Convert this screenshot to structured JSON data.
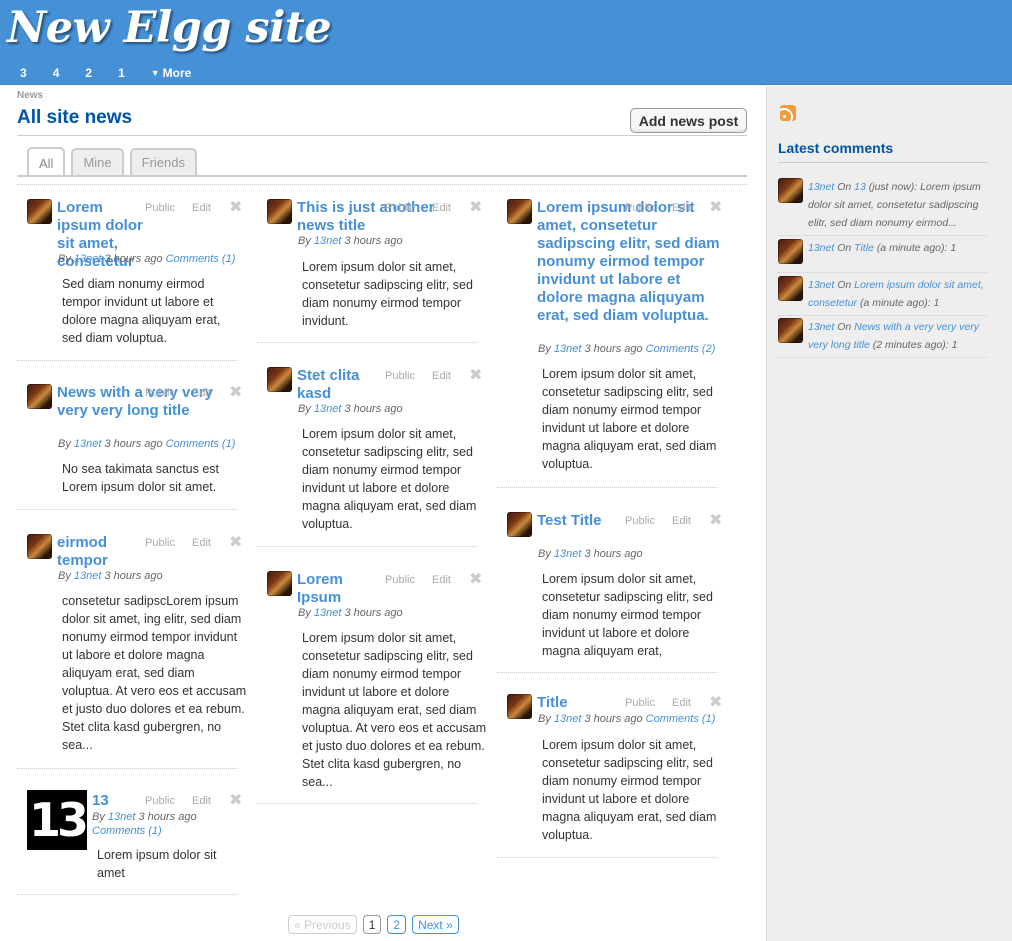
{
  "header": {
    "site_title": "New Elgg site",
    "nav": [
      "3",
      "4",
      "2",
      "1"
    ],
    "more_label": "More"
  },
  "breadcrumb": "News",
  "page_title": "All site news",
  "add_button": "Add news post",
  "tabs": [
    "All",
    "Mine",
    "Friends"
  ],
  "post_meta": {
    "access": "Public",
    "edit": "Edit",
    "delete": "✖"
  },
  "posts": [
    {
      "title": "Lorem ipsum dolor sit amet, consetetur",
      "by": "By",
      "author": "13net",
      "time": "3 hours ago",
      "comments": "Comments (1)",
      "excerpt": "Sed diam nonumy eirmod tempor invidunt ut labore et dolore magna aliquyam erat, sed diam voluptua."
    },
    {
      "title": "News with a very very very very long title",
      "by": "By",
      "author": "13net",
      "time": "3 hours ago",
      "comments": "Comments (1)",
      "excerpt": "No sea takimata sanctus est Lorem ipsum dolor sit amet."
    },
    {
      "title": "eirmod tempor",
      "by": "By",
      "author": "13net",
      "time": "3 hours ago",
      "comments": "",
      "excerpt": "consetetur sadipscLorem ipsum dolor sit amet, ing elitr, sed diam nonumy eirmod tempor invidunt ut labore et dolore magna aliquyam erat, sed diam voluptua. At vero eos et accusam et justo duo dolores et ea rebum. Stet clita kasd gubergren, no sea..."
    },
    {
      "title": "13",
      "by": "By",
      "author": "13net",
      "time": "3 hours ago",
      "comments": "Comments (1)",
      "excerpt": "Lorem ipsum dolor sit amet"
    },
    {
      "title": "This is just another news title",
      "by": "By",
      "author": "13net",
      "time": "3 hours ago",
      "comments": "",
      "excerpt": "Lorem ipsum dolor sit amet, consetetur sadipscing elitr, sed diam nonumy eirmod tempor invidunt."
    },
    {
      "title": "Stet clita kasd",
      "by": "By",
      "author": "13net",
      "time": "3 hours ago",
      "comments": "",
      "excerpt": "Lorem ipsum dolor sit amet, consetetur sadipscing elitr, sed diam nonumy eirmod tempor invidunt ut labore et dolore magna aliquyam erat, sed diam voluptua."
    },
    {
      "title": "Lorem Ipsum",
      "by": "By",
      "author": "13net",
      "time": "3 hours ago",
      "comments": "",
      "excerpt": "Lorem ipsum dolor sit amet, consetetur sadipscing elitr, sed diam nonumy eirmod tempor invidunt ut labore et dolore magna aliquyam erat, sed diam voluptua. At vero eos et accusam et justo duo dolores et ea rebum. Stet clita kasd gubergren, no sea..."
    },
    {
      "title": "Lorem ipsum dolor sit amet, consetetur sadipscing elitr, sed diam nonumy eirmod tempor invidunt ut labore et dolore magna aliquyam erat, sed diam voluptua.",
      "by": "By",
      "author": "13net",
      "time": "3 hours ago",
      "comments": "Comments (2)",
      "excerpt": "Lorem ipsum dolor sit amet, consetetur sadipscing elitr, sed diam nonumy eirmod tempor invidunt ut labore et dolore magna aliquyam erat, sed diam voluptua."
    },
    {
      "title": "Test Title",
      "by": "By",
      "author": "13net",
      "time": "3 hours ago",
      "comments": "",
      "excerpt": "Lorem ipsum dolor sit amet, consetetur sadipscing elitr, sed diam nonumy eirmod tempor invidunt ut labore et dolore magna aliquyam erat,"
    },
    {
      "title": "Title",
      "by": "By",
      "author": "13net",
      "time": "3 hours ago",
      "comments": "Comments (1)",
      "excerpt": "Lorem ipsum dolor sit amet, consetetur sadipscing elitr, sed diam nonumy eirmod tempor invidunt ut labore et dolore magna aliquyam erat, sed diam voluptua."
    }
  ],
  "pagination": {
    "previous": "« Previous",
    "pages": [
      "1",
      "2"
    ],
    "next": "Next »"
  },
  "sidebar": {
    "latest_title": "Latest comments",
    "comments": [
      {
        "author": "13net",
        "on": "On",
        "target": "13",
        "rest": "(just now): Lorem ipsum dolor sit amet, consetetur sadipscing elitr, sed diam nonumy eirmod..."
      },
      {
        "author": "13net",
        "on": "On",
        "target": "Title",
        "rest": "(a minute ago): 1"
      },
      {
        "author": "13net",
        "on": "On",
        "target": "Lorem ipsum dolor sit amet, consetetur",
        "rest": "(a minute ago): 1"
      },
      {
        "author": "13net",
        "on": "On",
        "target": "News with a very very very very long title",
        "rest": "(2 minutes ago): 1"
      }
    ]
  },
  "colors": {
    "header": "#4690d6",
    "title": "#0054a7",
    "link": "#4690d6"
  }
}
